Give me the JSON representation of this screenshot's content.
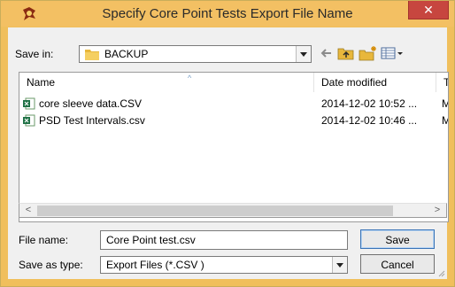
{
  "window": {
    "title": "Specify Core Point Tests Export File Name",
    "close_label": "✕"
  },
  "save_in": {
    "label": "Save in:",
    "value": "BACKUP"
  },
  "columns": [
    "Name",
    "Date modified",
    "Ty"
  ],
  "files": [
    {
      "name": "core sleeve data.CSV",
      "date": "2014-12-02 10:52 ...",
      "type": "M"
    },
    {
      "name": "PSD Test Intervals.csv",
      "date": "2014-12-02 10:46 ...",
      "type": "M"
    }
  ],
  "scroll": {
    "left": "<",
    "right": ">"
  },
  "file_name": {
    "label": "File name:",
    "value": "Core Point test.csv"
  },
  "save_as_type": {
    "label": "Save as type:",
    "value": "Export Files (*.CSV )"
  },
  "buttons": {
    "save": "Save",
    "cancel": "Cancel"
  },
  "colors": {
    "title_bar": "#f3c063",
    "close": "#c7463f",
    "excel_icon": "#1e7145"
  }
}
